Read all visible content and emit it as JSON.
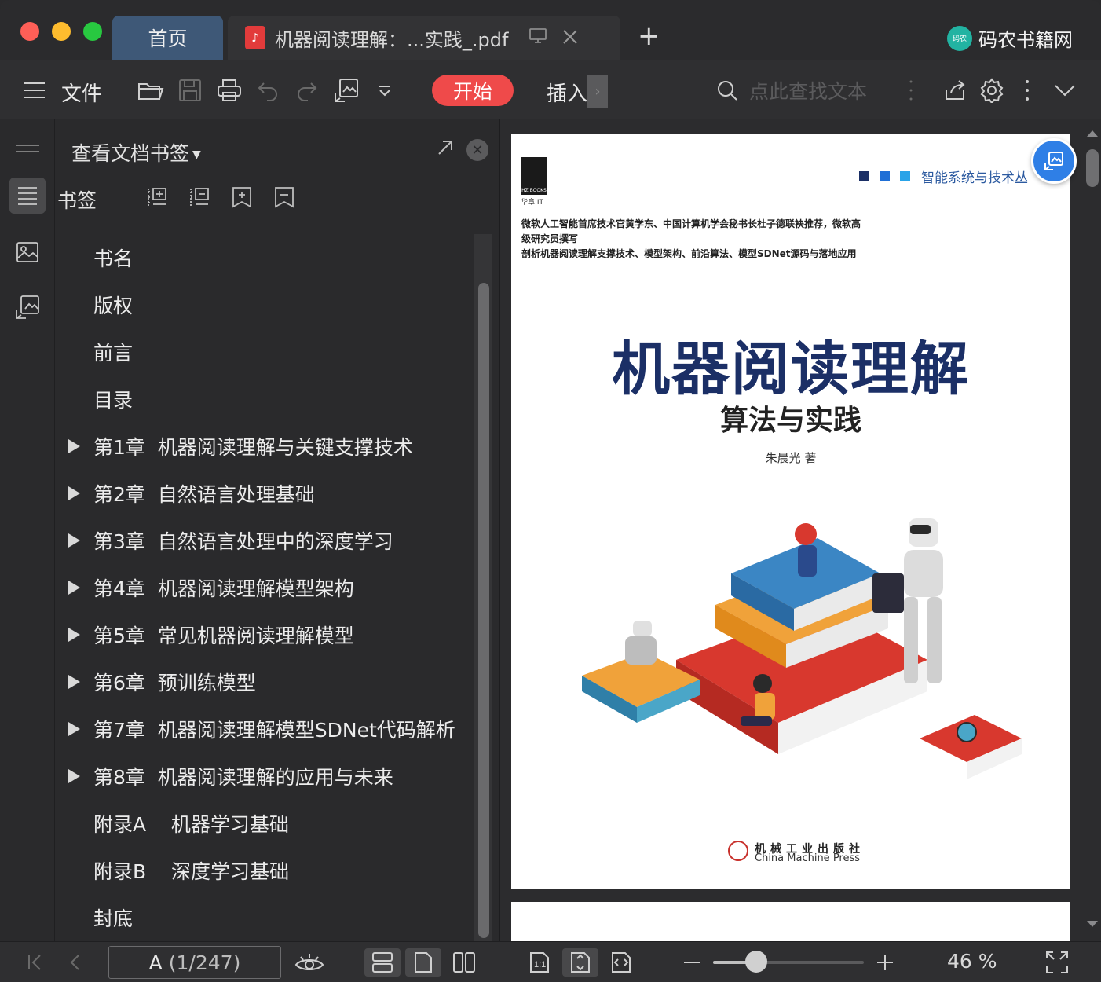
{
  "window": {
    "tabs": [
      {
        "label": "首页"
      },
      {
        "label": "机器阅读理解：...实践_.pdf"
      }
    ],
    "new_tab": "+",
    "brand": {
      "logo_text": "码农",
      "name": "码农书籍网"
    }
  },
  "toolbar": {
    "file_label": "文件",
    "start_label": "开始",
    "insert_label": "插入",
    "insert_overflow": "›",
    "search_placeholder": "点此查找文本"
  },
  "panel": {
    "title": "查看文档书签",
    "bookmarks_label": "书签",
    "items": [
      {
        "label": "书名",
        "expandable": false
      },
      {
        "label": "版权",
        "expandable": false
      },
      {
        "label": "前言",
        "expandable": false
      },
      {
        "label": "目录",
        "expandable": false
      },
      {
        "label": "第1章  机器阅读理解与关键支撑技术",
        "expandable": true
      },
      {
        "label": "第2章  自然语言处理基础",
        "expandable": true
      },
      {
        "label": "第3章  自然语言处理中的深度学习",
        "expandable": true
      },
      {
        "label": "第4章  机器阅读理解模型架构",
        "expandable": true
      },
      {
        "label": "第5章  常见机器阅读理解模型",
        "expandable": true
      },
      {
        "label": "第6章  预训练模型",
        "expandable": true
      },
      {
        "label": "第7章  机器阅读理解模型SDNet代码解析",
        "expandable": true
      },
      {
        "label": "第8章  机器阅读理解的应用与未来",
        "expandable": true
      },
      {
        "label": "附录A    机器学习基础",
        "expandable": false
      },
      {
        "label": "附录B    深度学习基础",
        "expandable": false
      },
      {
        "label": "封底",
        "expandable": false
      }
    ]
  },
  "cover": {
    "publisher_logo": "HZ BOOKS",
    "publisher_sub": "华章 IT",
    "series": "智能系统与技术丛",
    "blurb": [
      "微软人工智能首席技术官黄学东、中国计算机学会秘书长杜子德联袂推荐，微软高",
      "级研究员撰写",
      "剖析机器阅读理解支撑技术、模型架构、前沿算法、模型SDNet源码与落地应用"
    ],
    "title": "机器阅读理解",
    "subtitle": "算法与实践",
    "author": "朱晨光  著",
    "press_cn": "机械工业出版社",
    "press_en": "China Machine Press"
  },
  "statusbar": {
    "page_current": "A",
    "page_total": "(1/247)",
    "zoom_text": "46 %",
    "zoom_level": 0.46
  },
  "colors": {
    "accent_start": "#ef4a4a",
    "home_tab": "#3e5877",
    "cover_title": "#1b2f66",
    "series_blue": "#2c5aa0",
    "float_button": "#2f7fe6"
  }
}
